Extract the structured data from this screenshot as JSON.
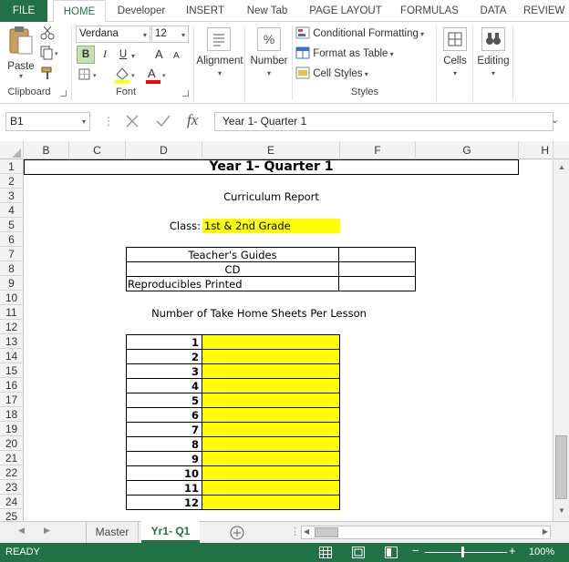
{
  "ribbon_tabs": [
    "FILE",
    "HOME",
    "Developer",
    "INSERT",
    "New Tab",
    "PAGE LAYOUT",
    "FORMULAS",
    "DATA",
    "REVIEW"
  ],
  "clipboard": {
    "paste": "Paste",
    "label": "Clipboard"
  },
  "font": {
    "name": "Verdana",
    "size": "12",
    "bold": "B",
    "italic": "I",
    "underline": "U",
    "grow": "A",
    "shrink": "A",
    "label": "Font"
  },
  "alignment": {
    "label": "Alignment"
  },
  "number": {
    "label": "Number",
    "symbol": "%"
  },
  "styles": {
    "conditional": "Conditional Formatting",
    "format_table": "Format as Table",
    "cell_styles": "Cell Styles",
    "label": "Styles"
  },
  "cells": {
    "label": "Cells"
  },
  "editing": {
    "label": "Editing"
  },
  "formula_bar": {
    "name_box": "B1",
    "fx": "fx",
    "content": "Year 1- Quarter 1"
  },
  "columns": [
    "B",
    "C",
    "D",
    "E",
    "F",
    "G",
    "H"
  ],
  "rows": [
    "1",
    "2",
    "3",
    "4",
    "5",
    "6",
    "7",
    "8",
    "9",
    "10",
    "11",
    "12",
    "13",
    "14",
    "15",
    "16",
    "17",
    "18",
    "19",
    "20",
    "21",
    "22",
    "23",
    "24",
    "25"
  ],
  "sheet": {
    "title": "Year 1- Quarter 1",
    "subtitle": "Curriculum Report",
    "class_label": "Class:",
    "class_value": "1st & 2nd Grade",
    "materials": [
      "Teacher's Guides",
      "CD",
      "Reproducibles Printed"
    ],
    "lesson_header": "Number of Take Home Sheets Per Lesson",
    "lessons": [
      "1",
      "2",
      "3",
      "4",
      "5",
      "6",
      "7",
      "8",
      "9",
      "10",
      "11",
      "12"
    ]
  },
  "sheet_tabs": [
    "Master",
    "Yr1- Q1"
  ],
  "status": {
    "ready": "READY",
    "zoom": "100%"
  },
  "colors": {
    "excel_green": "#217346",
    "highlight": "#ffff00"
  }
}
